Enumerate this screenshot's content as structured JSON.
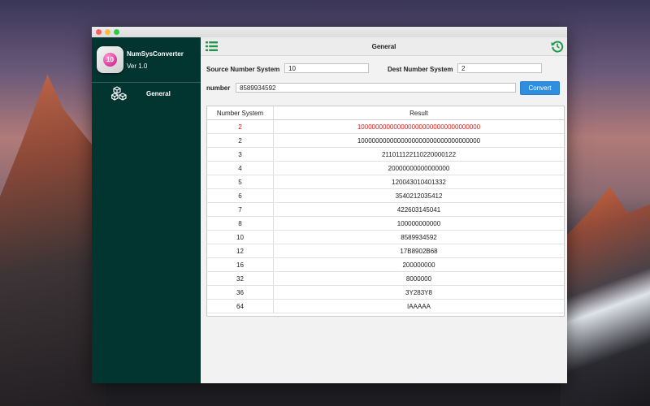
{
  "app": {
    "name": "NumSysConverter",
    "version": "Ver 1.0",
    "icon_text": "10"
  },
  "sidebar": {
    "items": [
      {
        "label": "General",
        "icon": "cubes-icon"
      }
    ]
  },
  "toolbar": {
    "title": "General",
    "left_icon": "list-icon",
    "right_icon": "refresh-icon"
  },
  "form": {
    "source_label": "Source Number System",
    "source_value": "10",
    "dest_label": "Dest Number System",
    "dest_value": "2",
    "number_label": "number",
    "number_value": "8589934592",
    "convert_label": "Convert"
  },
  "table": {
    "headers": [
      "Number System",
      "Result"
    ],
    "rows": [
      [
        "2",
        "1000000000000000000000000000000000"
      ],
      [
        "2",
        "1000000000000000000000000000000000"
      ],
      [
        "3",
        "211011122110220000122"
      ],
      [
        "4",
        "20000000000000000"
      ],
      [
        "5",
        "120043010401332"
      ],
      [
        "6",
        "3540212035412"
      ],
      [
        "7",
        "422603145041"
      ],
      [
        "8",
        "100000000000"
      ],
      [
        "10",
        "8589934592"
      ],
      [
        "12",
        "17B8902B68"
      ],
      [
        "16",
        "200000000"
      ],
      [
        "32",
        "8000000"
      ],
      [
        "36",
        "3Y283Y8"
      ],
      [
        "64",
        "IAAAAA"
      ]
    ],
    "highlight_row": 0
  },
  "colors": {
    "sidebar": "#023530",
    "accent": "#2f8ee0",
    "highlight": "#e01515",
    "icon_green": "#1a9a4a"
  }
}
